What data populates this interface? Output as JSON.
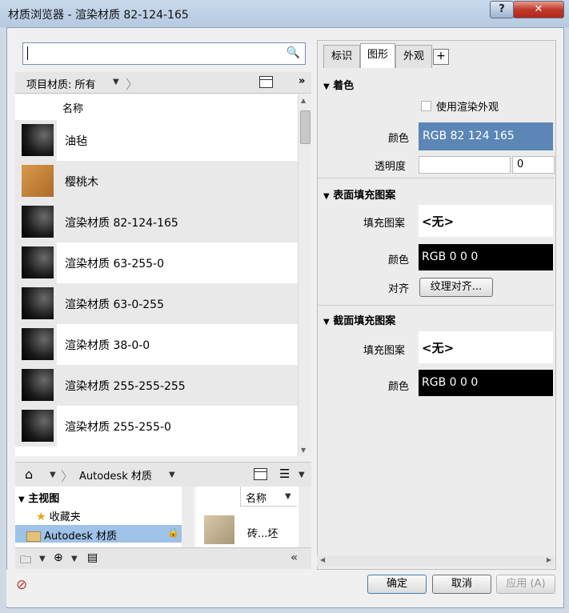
{
  "window": {
    "title": "材质浏览器 - 渲染材质 82-124-165",
    "help": "?",
    "close": "✕"
  },
  "search": {
    "value": "",
    "placeholder": ""
  },
  "filter": {
    "label": "项目材质: 所有"
  },
  "list": {
    "header_name": "名称",
    "items": [
      {
        "label": "油毡",
        "thumb": "render"
      },
      {
        "label": "樱桃木",
        "thumb": "wood"
      },
      {
        "label": "渲染材质 82-124-165",
        "thumb": "render"
      },
      {
        "label": "渲染材质 63-255-0",
        "thumb": "render"
      },
      {
        "label": "渲染材质 63-0-255",
        "thumb": "render"
      },
      {
        "label": "渲染材质 38-0-0",
        "thumb": "render"
      },
      {
        "label": "渲染材质 255-255-255",
        "thumb": "render"
      },
      {
        "label": "渲染材质 255-255-0",
        "thumb": "render"
      }
    ]
  },
  "library": {
    "breadcrumb": "Autodesk 材质",
    "tree": {
      "root": "主视图",
      "favorites": "收藏夹",
      "selected": "Autodesk 材质"
    },
    "grid": {
      "header": "名称",
      "item": "砖...坯"
    }
  },
  "tabs": {
    "ident": "标识",
    "graphics": "图形",
    "appearance": "外观",
    "add": "+"
  },
  "shading": {
    "title": "着色",
    "use_render_appearance": "使用渲染外观",
    "color_label": "颜色",
    "color_value": "RGB 82 124 165",
    "color_hex": "#5b86b5",
    "transparency_label": "透明度",
    "transparency_value": "0"
  },
  "surface": {
    "title": "表面填充图案",
    "pattern_label": "填充图案",
    "pattern_value": "<无>",
    "color_label": "颜色",
    "color_value": "RGB 0 0 0",
    "align_label": "对齐",
    "align_button": "纹理对齐..."
  },
  "cut": {
    "title": "截面填充图案",
    "pattern_label": "填充图案",
    "pattern_value": "<无>",
    "color_label": "颜色",
    "color_value": "RGB 0 0 0"
  },
  "footer": {
    "ok": "确定",
    "cancel": "取消",
    "apply": "应用 (A)"
  }
}
